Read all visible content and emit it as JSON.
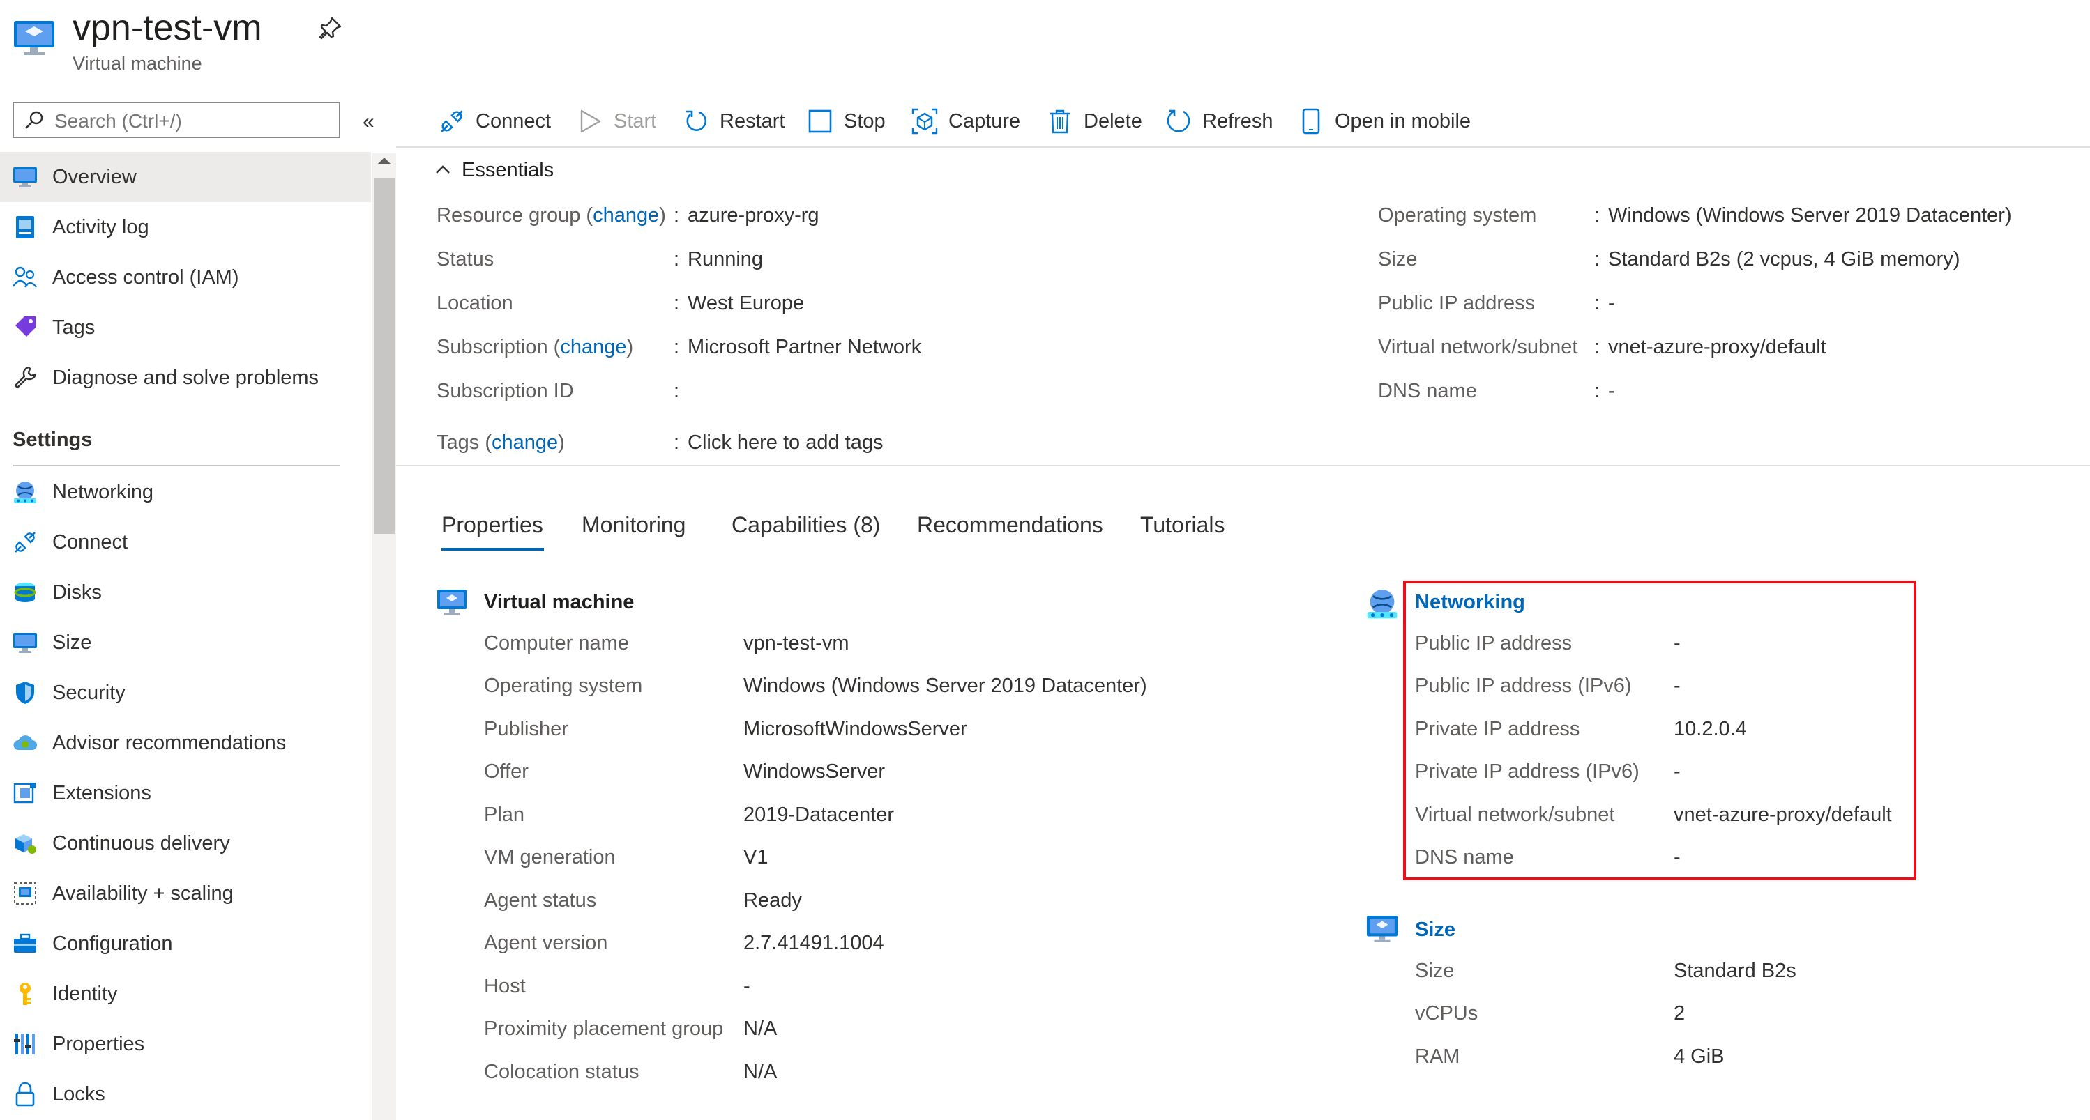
{
  "header": {
    "title": "vpn-test-vm",
    "subtitle": "Virtual machine",
    "icons": [
      "virtual-machine-icon",
      "pin-icon"
    ]
  },
  "search": {
    "placeholder": "Search (Ctrl+/)"
  },
  "sidebar": {
    "items_top": [
      {
        "label": "Overview",
        "icon": "monitor-icon",
        "selected": true
      },
      {
        "label": "Activity log",
        "icon": "log-icon"
      },
      {
        "label": "Access control (IAM)",
        "icon": "users-icon"
      },
      {
        "label": "Tags",
        "icon": "tag-icon"
      },
      {
        "label": "Diagnose and solve problems",
        "icon": "wrench-icon"
      }
    ],
    "settings_heading": "Settings",
    "items_settings": [
      {
        "label": "Networking",
        "icon": "globe-network-icon"
      },
      {
        "label": "Connect",
        "icon": "plug-icon"
      },
      {
        "label": "Disks",
        "icon": "disk-icon"
      },
      {
        "label": "Size",
        "icon": "monitor-icon"
      },
      {
        "label": "Security",
        "icon": "shield-icon"
      },
      {
        "label": "Advisor recommendations",
        "icon": "cloud-advisor-icon"
      },
      {
        "label": "Extensions",
        "icon": "extensions-icon"
      },
      {
        "label": "Continuous delivery",
        "icon": "delivery-icon"
      },
      {
        "label": "Availability + scaling",
        "icon": "scaling-icon"
      },
      {
        "label": "Configuration",
        "icon": "toolbox-icon"
      },
      {
        "label": "Identity",
        "icon": "key-icon"
      },
      {
        "label": "Properties",
        "icon": "bars-icon"
      },
      {
        "label": "Locks",
        "icon": "lock-icon"
      }
    ]
  },
  "toolbar": {
    "buttons": [
      {
        "label": "Connect",
        "icon": "plug-icon",
        "enabled": true
      },
      {
        "label": "Start",
        "icon": "play-icon",
        "enabled": false
      },
      {
        "label": "Restart",
        "icon": "restart-icon",
        "enabled": true
      },
      {
        "label": "Stop",
        "icon": "stop-icon",
        "enabled": true
      },
      {
        "label": "Capture",
        "icon": "capture-icon",
        "enabled": true
      },
      {
        "label": "Delete",
        "icon": "trash-icon",
        "enabled": true
      },
      {
        "label": "Refresh",
        "icon": "refresh-icon",
        "enabled": true
      },
      {
        "label": "Open in mobile",
        "icon": "mobile-icon",
        "enabled": true
      }
    ]
  },
  "essentials": {
    "heading": "Essentials",
    "left": [
      {
        "label": "Resource group",
        "change": "change",
        "value": "azure-proxy-rg",
        "link": true
      },
      {
        "label": "Status",
        "value": "Running"
      },
      {
        "label": "Location",
        "value": "West Europe"
      },
      {
        "label": "Subscription",
        "change": "change",
        "value": "Microsoft Partner Network",
        "link": true
      },
      {
        "label": "Subscription ID",
        "value": ""
      },
      {
        "label": "Tags",
        "change": "change",
        "value": "Click here to add tags",
        "link": true
      }
    ],
    "right": [
      {
        "label": "Operating system",
        "value": "Windows (Windows Server 2019 Datacenter)"
      },
      {
        "label": "Size",
        "value": "Standard B2s (2 vcpus, 4 GiB memory)"
      },
      {
        "label": "Public IP address",
        "value": "-"
      },
      {
        "label": "Virtual network/subnet",
        "value": "vnet-azure-proxy/default",
        "link": true
      },
      {
        "label": "DNS name",
        "value": "-"
      }
    ]
  },
  "tabs": [
    {
      "label": "Properties",
      "active": true
    },
    {
      "label": "Monitoring"
    },
    {
      "label": "Capabilities (8)"
    },
    {
      "label": "Recommendations"
    },
    {
      "label": "Tutorials"
    }
  ],
  "vm_group": {
    "title": "Virtual machine",
    "rows": [
      {
        "label": "Computer name",
        "value": "vpn-test-vm"
      },
      {
        "label": "Operating system",
        "value": "Windows (Windows Server 2019 Datacenter)"
      },
      {
        "label": "Publisher",
        "value": "MicrosoftWindowsServer"
      },
      {
        "label": "Offer",
        "value": "WindowsServer"
      },
      {
        "label": "Plan",
        "value": "2019-Datacenter"
      },
      {
        "label": "VM generation",
        "value": "V1"
      },
      {
        "label": "Agent status",
        "value": "Ready"
      },
      {
        "label": "Agent version",
        "value": "2.7.41491.1004"
      },
      {
        "label": "Host",
        "value": "-"
      },
      {
        "label": "Proximity placement group",
        "value": "N/A"
      },
      {
        "label": "Colocation status",
        "value": "N/A"
      }
    ]
  },
  "networking_group": {
    "title": "Networking",
    "rows": [
      {
        "label": "Public IP address",
        "value": "-"
      },
      {
        "label": "Public IP address (IPv6)",
        "value": "-"
      },
      {
        "label": "Private IP address",
        "value": "10.2.0.4"
      },
      {
        "label": "Private IP address (IPv6)",
        "value": "-"
      },
      {
        "label": "Virtual network/subnet",
        "value": "vnet-azure-proxy/default",
        "link": true
      },
      {
        "label": "DNS name",
        "value": "-"
      }
    ],
    "highlight_color": "#e3101e"
  },
  "size_group": {
    "title": "Size",
    "rows": [
      {
        "label": "Size",
        "value": "Standard B2s"
      },
      {
        "label": "vCPUs",
        "value": "2"
      },
      {
        "label": "RAM",
        "value": "4 GiB"
      }
    ]
  },
  "colors": {
    "accent": "#0067b8",
    "selected_bg": "#edebe9"
  }
}
